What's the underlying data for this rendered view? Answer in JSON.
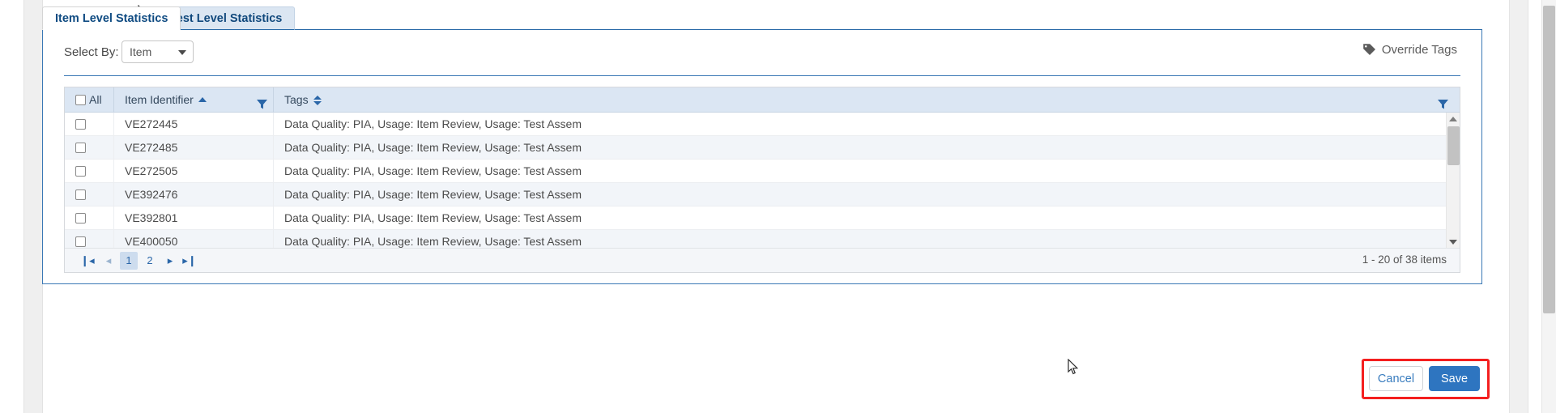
{
  "tabs": [
    {
      "label": "Item Level Statistics",
      "active": true
    },
    {
      "label": "Test Level Statistics",
      "active": false
    }
  ],
  "toolbar": {
    "select_by_label": "Select By:",
    "select_by_value": "Item",
    "select_by_options": [
      "Item"
    ],
    "override_tags_label": "Override Tags",
    "override_tags_icon": "tag-icon",
    "caret_icon": "chevron-down-icon"
  },
  "grid": {
    "columns": [
      {
        "key": "check",
        "label": "All",
        "sort": "none",
        "filter": false
      },
      {
        "key": "id",
        "label": "Item Identifier",
        "sort": "asc",
        "filter": true
      },
      {
        "key": "tags",
        "label": "Tags",
        "sort": "both",
        "filter": true
      }
    ],
    "select_all_label": "All",
    "filter_icon": "filter-funnel-icon",
    "sort_asc_icon": "sort-ascending-icon",
    "sort_both_icon": "sort-updown-icon",
    "rows": [
      {
        "checked": false,
        "id": "VE272445",
        "tags": "Data Quality: PIA, Usage: Item Review, Usage: Test Assem"
      },
      {
        "checked": false,
        "id": "VE272485",
        "tags": "Data Quality: PIA, Usage: Item Review, Usage: Test Assem"
      },
      {
        "checked": false,
        "id": "VE272505",
        "tags": "Data Quality: PIA, Usage: Item Review, Usage: Test Assem"
      },
      {
        "checked": false,
        "id": "VE392476",
        "tags": "Data Quality: PIA, Usage: Item Review, Usage: Test Assem"
      },
      {
        "checked": false,
        "id": "VE392801",
        "tags": "Data Quality: PIA, Usage: Item Review, Usage: Test Assem"
      },
      {
        "checked": false,
        "id": "VE400050",
        "tags": "Data Quality: PIA, Usage: Item Review, Usage: Test Assem"
      }
    ],
    "scrollbar": {
      "up_icon": "scroll-up-arrow-icon",
      "down_icon": "scroll-down-arrow-icon"
    }
  },
  "pager": {
    "first_icon": "◀|",
    "first_label": "❙◂",
    "prev_label": "◂",
    "next_label": "▸",
    "last_label": "▸❙",
    "pages": [
      {
        "label": "1",
        "active": true
      },
      {
        "label": "2",
        "active": false
      }
    ],
    "info": "1 - 20 of 38 items"
  },
  "footer": {
    "cancel_label": "Cancel",
    "save_label": "Save"
  },
  "annotation": {
    "color": "#f41f1f"
  },
  "colors": {
    "accent": "#2a66a8",
    "primary_button": "#2e75c0",
    "header_bg": "#dbe6f3",
    "row_alt_bg": "#f2f5f9",
    "annotation_red": "#f41f1f"
  }
}
